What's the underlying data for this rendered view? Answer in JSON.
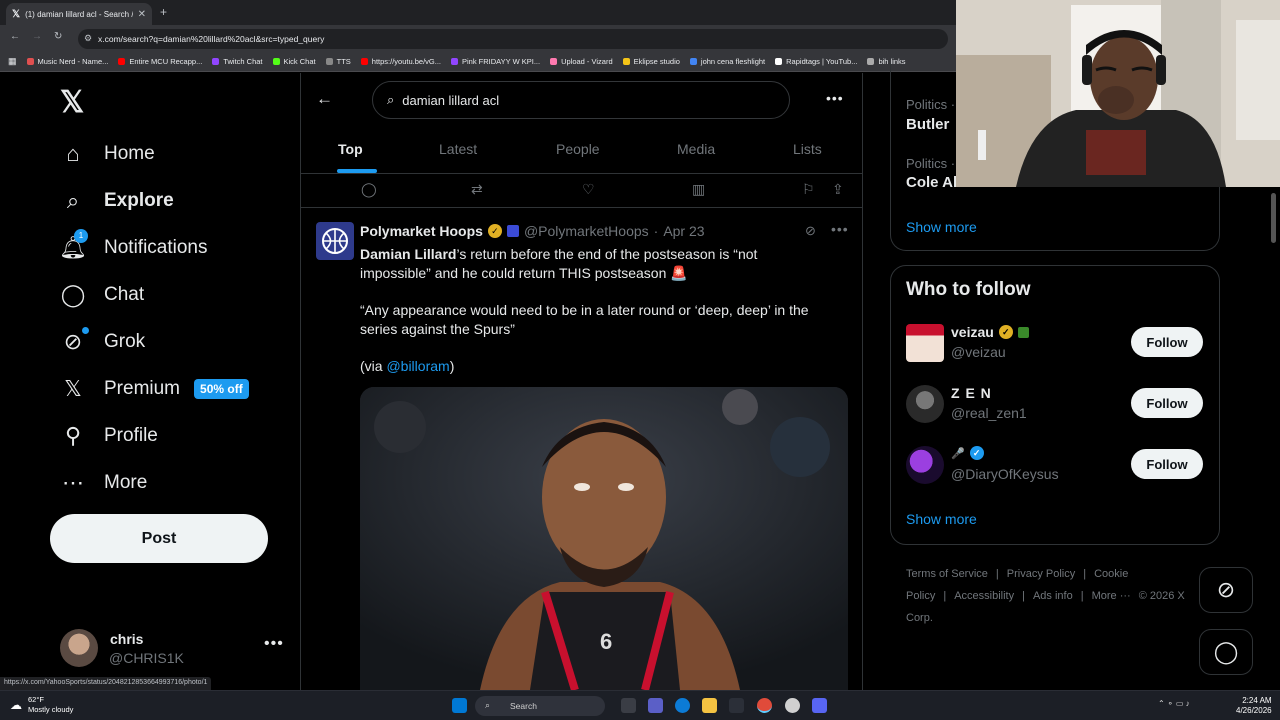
{
  "browser": {
    "tab_title": "(1) damian lillard acl - Search /",
    "url": "x.com/search?q=damian%20lillard%20acl&src=typed_query",
    "status_url": "https://x.com/YahooSports/status/2048212853664993716/photo/1",
    "bookmarks": [
      {
        "label": "Music Nerd - Name...",
        "color": "#e05050"
      },
      {
        "label": "Entire MCU Recapp...",
        "color": "#ff0000"
      },
      {
        "label": "Twitch Chat",
        "color": "#9146ff"
      },
      {
        "label": "Kick Chat",
        "color": "#53fc18"
      },
      {
        "label": "TTS",
        "color": "#888888"
      },
      {
        "label": "https://youtu.be/vG...",
        "color": "#ff0000"
      },
      {
        "label": "Pink FRIDAYY W KPI...",
        "color": "#9146ff"
      },
      {
        "label": "Upload - Vizard",
        "color": "#ff7ab0"
      },
      {
        "label": "Eklipse studio",
        "color": "#f5c518"
      },
      {
        "label": "john cena fleshlight",
        "color": "#4285f4"
      },
      {
        "label": "Rapidtags | YouTub...",
        "color": "#ffffff"
      },
      {
        "label": "bih links",
        "color": "#aaaaaa"
      }
    ]
  },
  "sidebar": {
    "items": [
      {
        "label": "Home",
        "icon": "home-icon"
      },
      {
        "label": "Explore",
        "icon": "search-icon"
      },
      {
        "label": "Notifications",
        "icon": "bell-icon",
        "badge": "1"
      },
      {
        "label": "Chat",
        "icon": "chat-icon"
      },
      {
        "label": "Grok",
        "icon": "grok-icon"
      },
      {
        "label": "Premium",
        "icon": "x-icon",
        "badge": "50% off"
      },
      {
        "label": "Profile",
        "icon": "person-icon"
      },
      {
        "label": "More",
        "icon": "more-circle-icon"
      }
    ],
    "post_label": "Post",
    "account": {
      "name": "chris",
      "handle": "@CHRIS1K"
    }
  },
  "search": {
    "query": "damian lillard acl",
    "tabs": [
      "Top",
      "Latest",
      "People",
      "Media",
      "Lists"
    ],
    "active_tab": "Top"
  },
  "tweet": {
    "author": "Polymarket Hoops",
    "handle": "@PolymarketHoops",
    "date": "Apr 23",
    "text_bold": "Damian Lillard",
    "text_1": "’s return before the end of the postseason is “not impossible” and he could return THIS postseason 🚨",
    "text_2": "“Any appearance would need to be in a later round or ‘deep, deep’ in the series against the Spurs”",
    "via_prefix": "(via ",
    "via_link": "@billoram",
    "via_suffix": ")"
  },
  "right_column": {
    "trends": [
      {
        "category": "Politics ·",
        "title": "Butler"
      },
      {
        "category": "Politics ·",
        "title": "Cole Allen"
      }
    ],
    "show_more_1": "Show more",
    "who_to_follow_title": "Who to follow",
    "who_to_follow": [
      {
        "name": "veizau",
        "handle": "@veizau",
        "follow": "Follow"
      },
      {
        "name": "Z E N",
        "handle": "@real_zen1",
        "follow": "Follow"
      },
      {
        "name": "🎤",
        "handle": "@DiaryOfKeysus",
        "follow": "Follow"
      }
    ],
    "show_more_2": "Show more",
    "footer": [
      "Terms of Service",
      "|",
      "Privacy Policy",
      "|",
      "Cookie Policy",
      "|",
      "Accessibility",
      "|",
      "Ads info",
      "|",
      "More ···",
      "© 2026 X Corp."
    ]
  },
  "taskbar": {
    "temp": "62°F",
    "weather": "Mostly cloudy",
    "search_label": "Search",
    "time": "2:24 AM",
    "date": "4/26/2026"
  },
  "colors": {
    "accent": "#1d9bf0",
    "background": "#000000",
    "text": "#e7e9ea",
    "muted": "#71767b"
  }
}
